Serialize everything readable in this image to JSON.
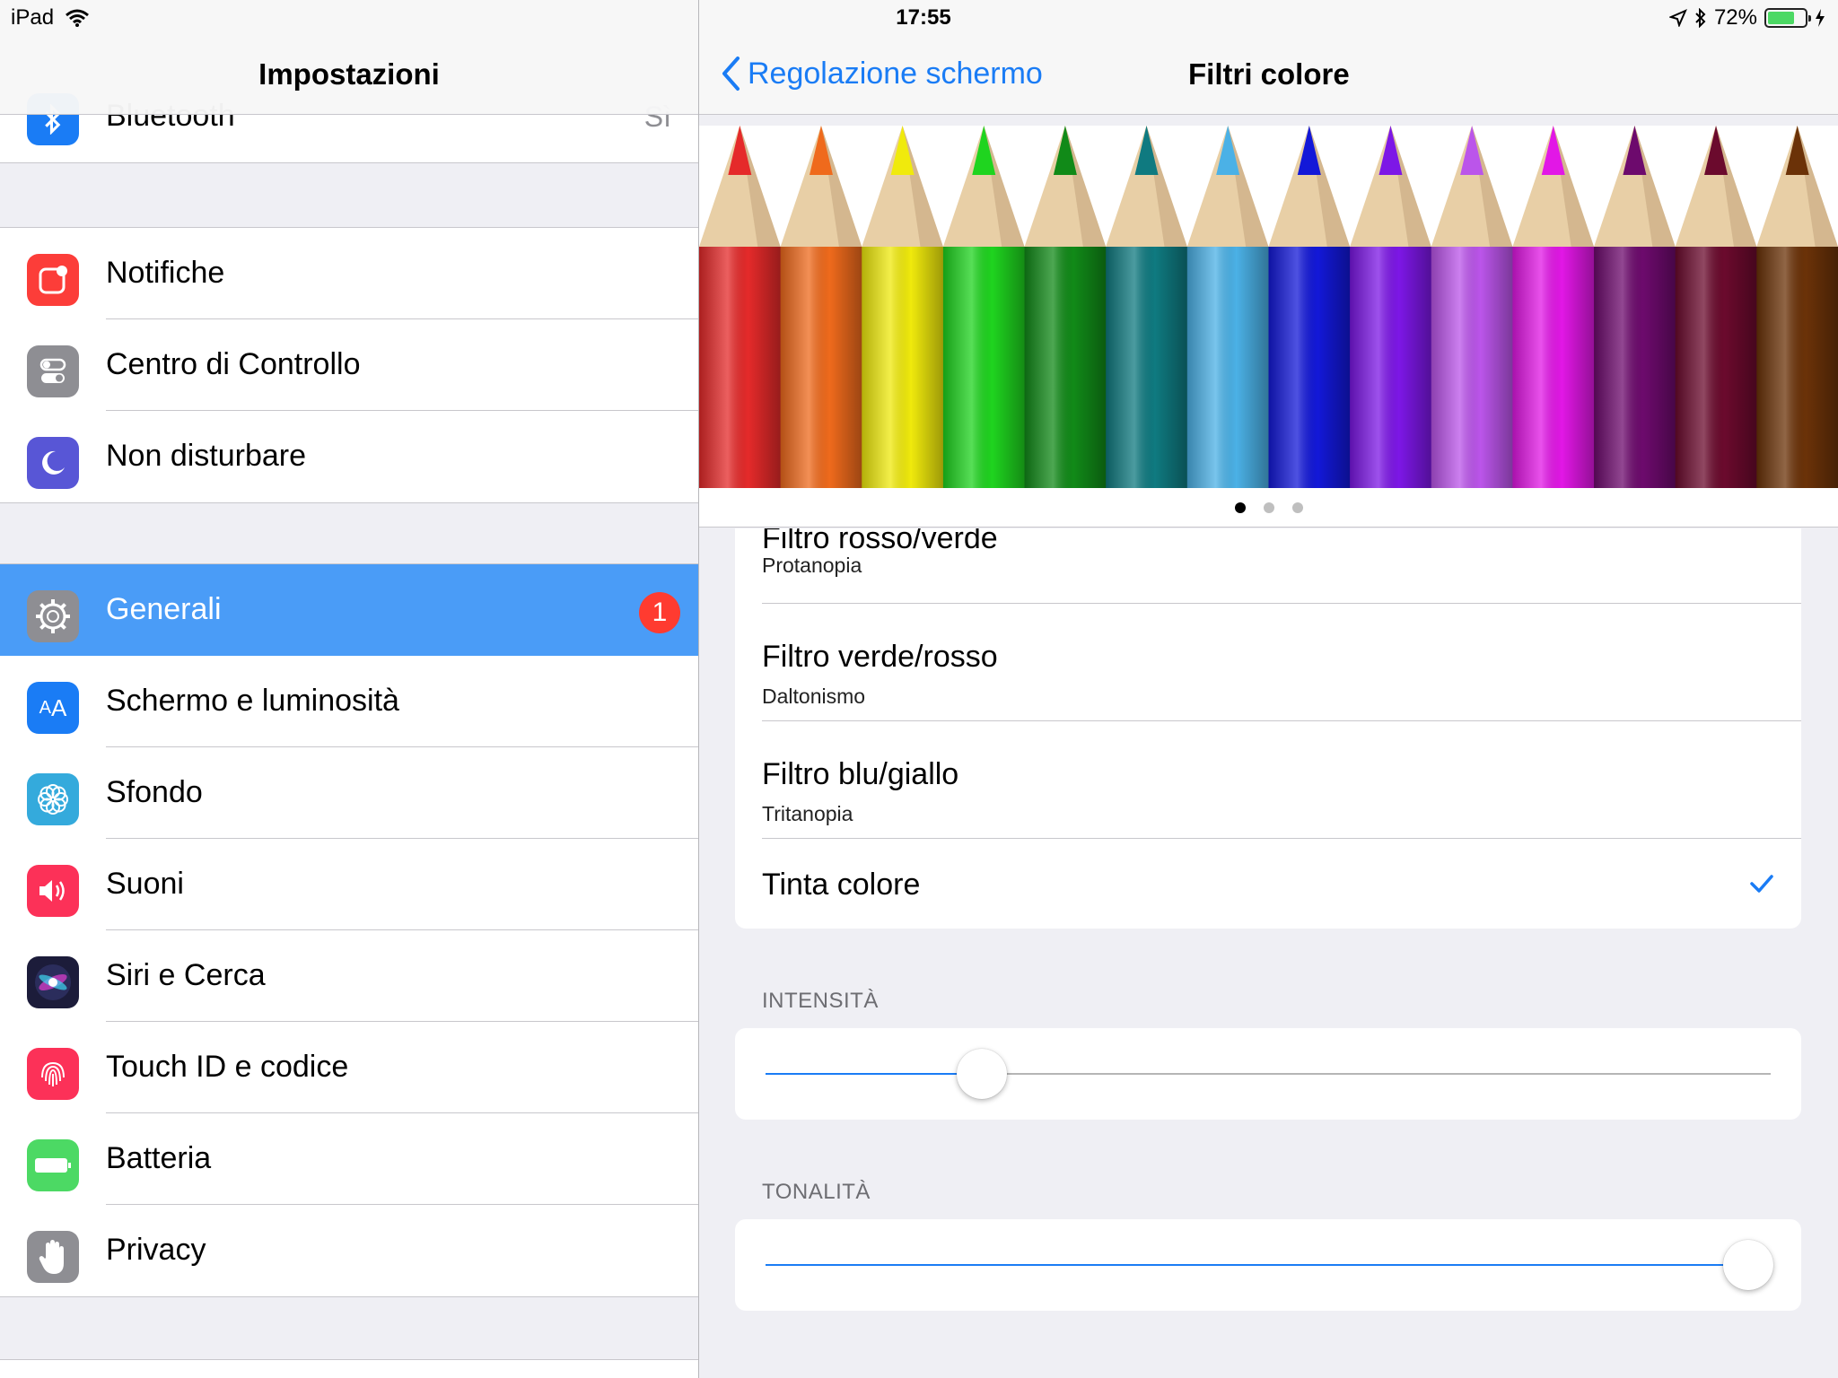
{
  "status_bar": {
    "device": "iPad",
    "time": "17:55",
    "battery": "72%",
    "battery_level": 0.72,
    "icons": [
      "wifi-icon",
      "location-icon",
      "bluetooth-icon",
      "battery-icon",
      "charging-icon"
    ]
  },
  "sidebar": {
    "title": "Impostazioni",
    "partial_item": {
      "label": "Bluetooth",
      "value": "Sì",
      "icon": "bluetooth-icon",
      "color": "#1a7cf5"
    },
    "group1": [
      {
        "label": "Notifiche",
        "icon": "notifications-icon",
        "color": "#fc3d39"
      },
      {
        "label": "Centro di Controllo",
        "icon": "control-center-icon",
        "color": "#8e8e93"
      },
      {
        "label": "Non disturbare",
        "icon": "moon-icon",
        "color": "#5856d6"
      }
    ],
    "group2": [
      {
        "label": "Generali",
        "icon": "gear-icon",
        "color": "#8e8e93",
        "badge": "1",
        "selected": true
      },
      {
        "label": "Schermo e luminosità",
        "icon": "display-icon",
        "color": "#1a7cf5"
      },
      {
        "label": "Sfondo",
        "icon": "wallpaper-icon",
        "color": "#34aadc"
      },
      {
        "label": "Suoni",
        "icon": "speaker-icon",
        "color": "#fc3158"
      },
      {
        "label": "Siri e Cerca",
        "icon": "siri-icon",
        "color": "#1c1c3a"
      },
      {
        "label": "Touch ID e codice",
        "icon": "fingerprint-icon",
        "color": "#fc3158"
      },
      {
        "label": "Batteria",
        "icon": "battery-icon",
        "color": "#4cd964"
      },
      {
        "label": "Privacy",
        "icon": "hand-icon",
        "color": "#8e8e93"
      }
    ]
  },
  "detail": {
    "back_label": "Regolazione schermo",
    "title": "Filtri colore",
    "pager": {
      "pages": 3,
      "current": 1
    },
    "filters": [
      {
        "title": "Filtro rosso/verde",
        "subtitle": "Protanopia"
      },
      {
        "title": "Filtro verde/rosso",
        "subtitle": "Daltonismo"
      },
      {
        "title": "Filtro blu/giallo",
        "subtitle": "Tritanopia"
      },
      {
        "title": "Tinta colore",
        "selected": true
      }
    ],
    "intensity": {
      "label": "INTENSITÀ",
      "value": 0.215
    },
    "hue": {
      "label": "TONALITÀ",
      "value": 0.978
    },
    "pencil_colors": [
      "#e52a2a",
      "#ef6a1c",
      "#f0ea0c",
      "#1fd41f",
      "#118a18",
      "#0f7a80",
      "#4bb1e6",
      "#1318d8",
      "#7d17e6",
      "#bb55ea",
      "#e217e6",
      "#6d0a6d",
      "#6b0a2d",
      "#6b3208"
    ],
    "accent": "#1a7cf5"
  }
}
